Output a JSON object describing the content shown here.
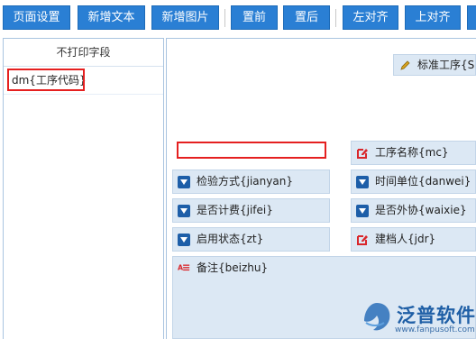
{
  "toolbar": {
    "page_settings": "页面设置",
    "add_text": "新增文本",
    "add_image": "新增图片",
    "bring_front": "置前",
    "send_back": "置后",
    "align_left": "左对齐",
    "align_top": "上对齐"
  },
  "left_panel": {
    "header": "不打印字段",
    "items": [
      "dm{工序代码}"
    ]
  },
  "canvas": {
    "title_field": "标准工序{S",
    "fields": {
      "process_name": "工序名称{mc}",
      "inspection_method": "检验方式{jianyan}",
      "time_unit": "时间单位{danwei}",
      "is_billed": "是否计费{jifei}",
      "is_outsourced": "是否外协{waixie}",
      "enabled_status": "启用状态{zt}",
      "creator": "建档人{jdr}",
      "remarks": "备注{beizhu}"
    }
  },
  "logo": {
    "name": "泛普软件",
    "url": "www.fanpusoft.com"
  },
  "colors": {
    "button": "#2a7fd4",
    "field_bg": "#dce8f4",
    "highlight": "#e52020",
    "icon_red": "#d9262b",
    "icon_blue": "#1d5ea8"
  }
}
